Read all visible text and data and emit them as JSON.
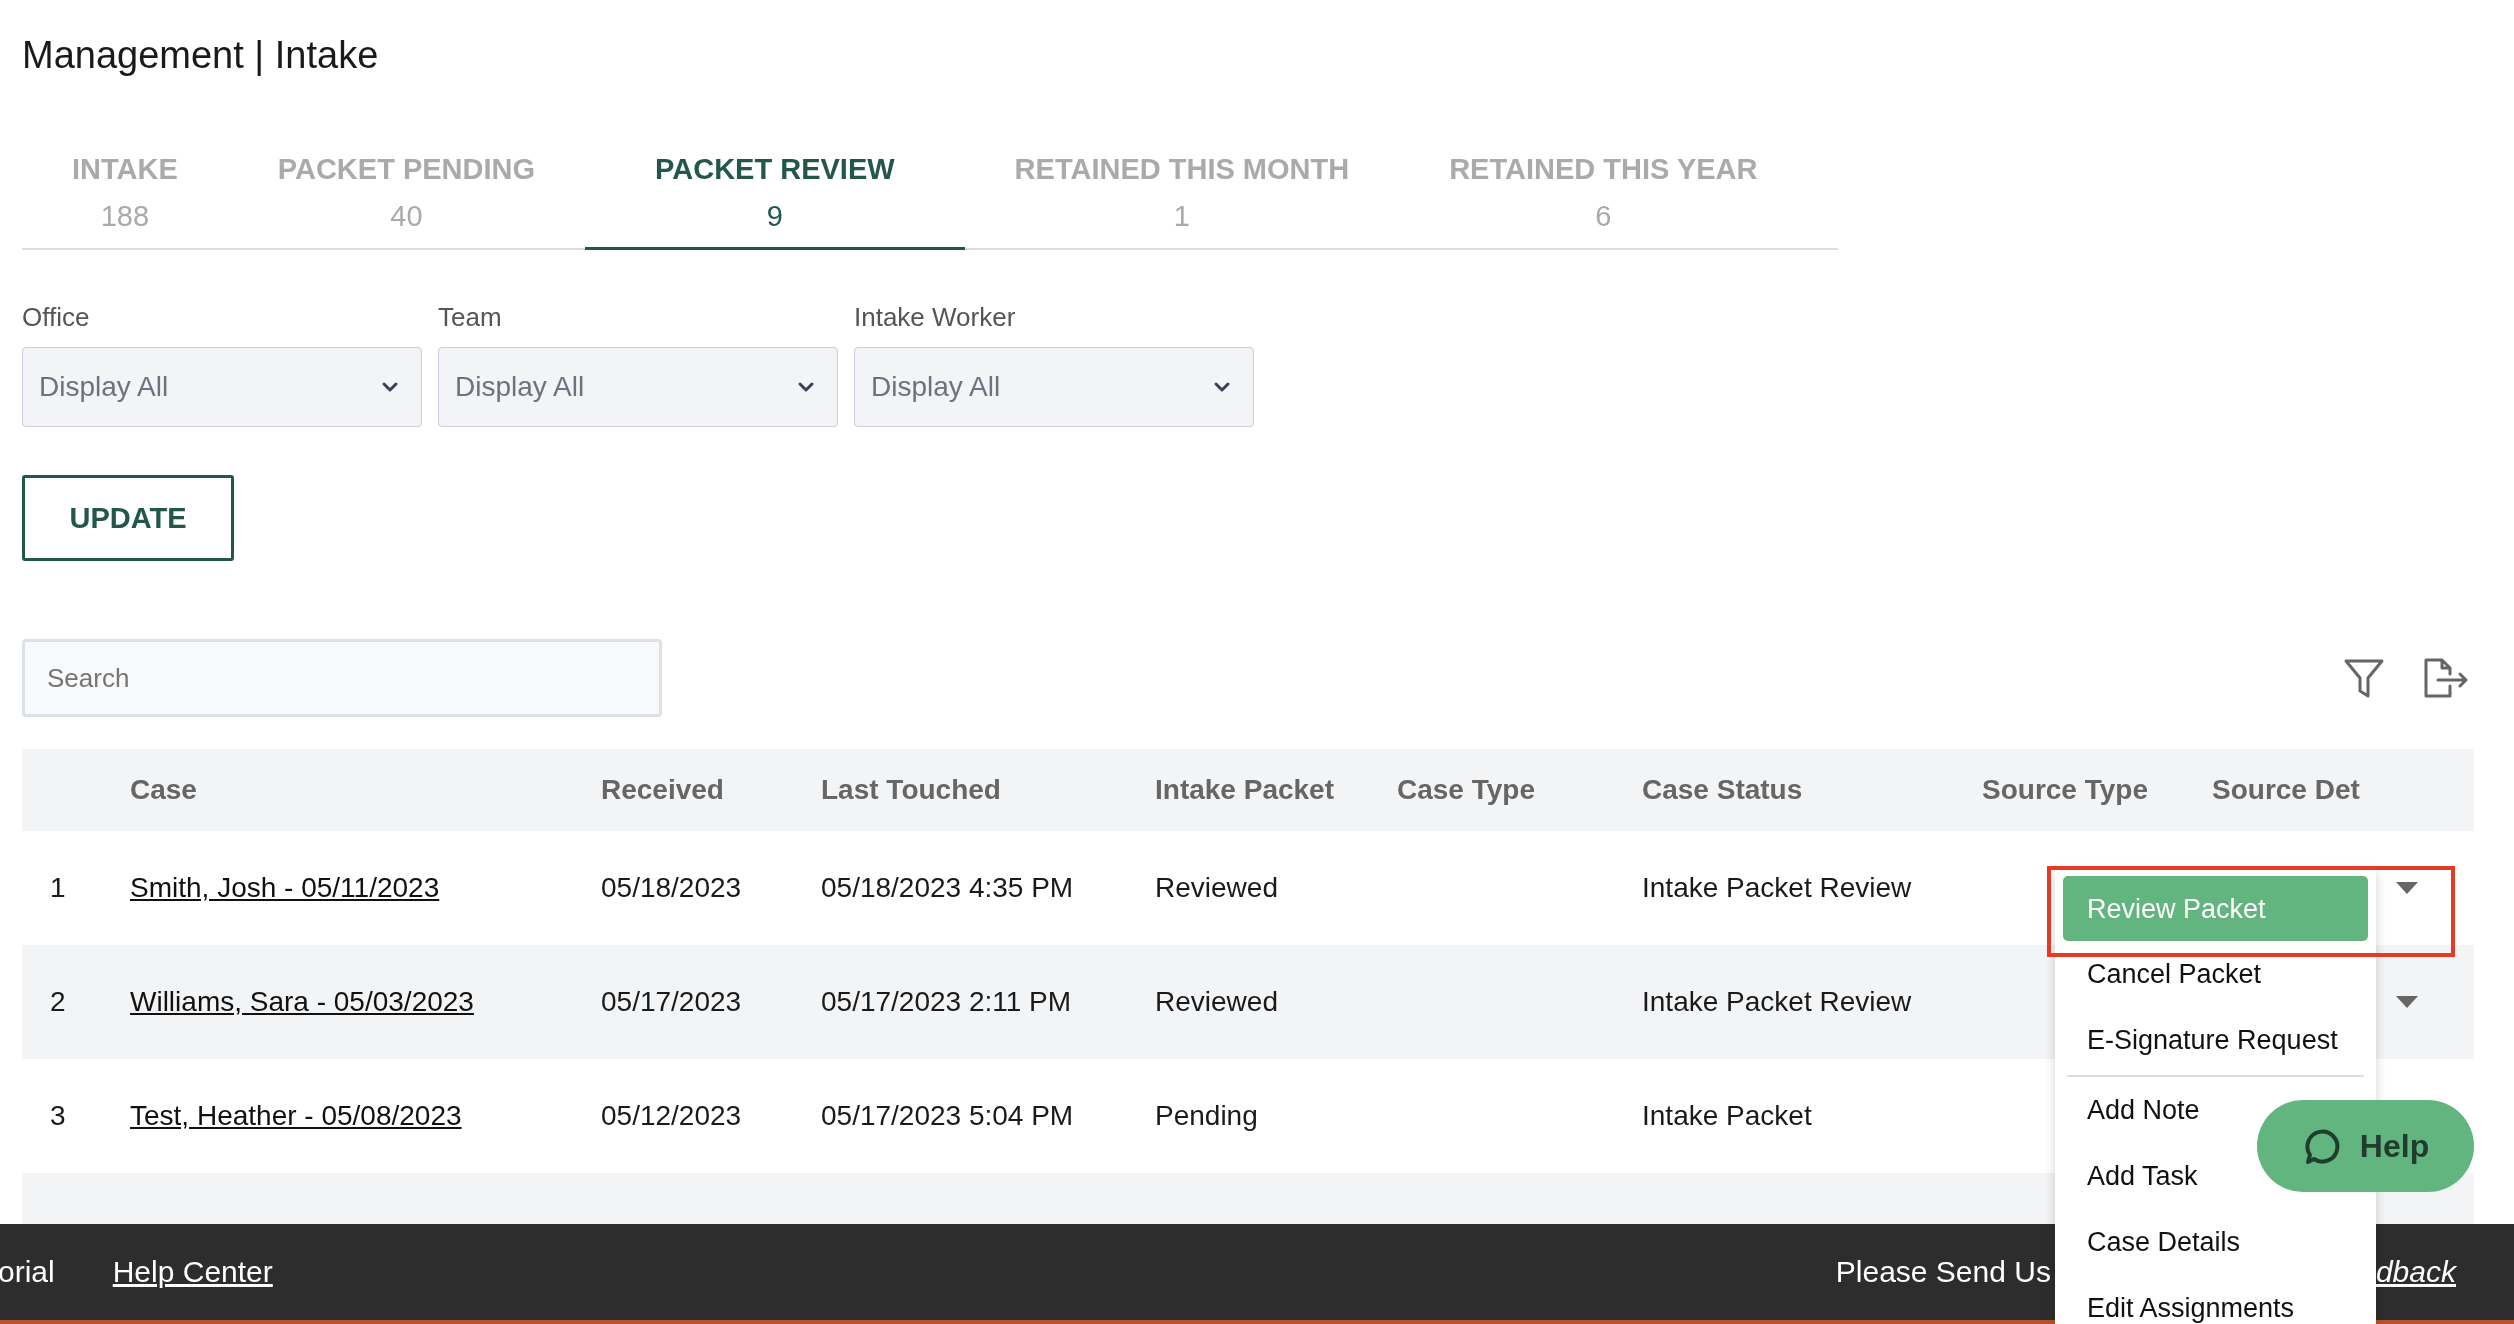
{
  "page_title": "Management | Intake",
  "tabs": [
    {
      "label": "INTAKE",
      "count": "188",
      "selected": false
    },
    {
      "label": "PACKET PENDING",
      "count": "40",
      "selected": false
    },
    {
      "label": "PACKET REVIEW",
      "count": "9",
      "selected": true
    },
    {
      "label": "RETAINED THIS MONTH",
      "count": "1",
      "selected": false
    },
    {
      "label": "RETAINED THIS YEAR",
      "count": "6",
      "selected": false
    }
  ],
  "filters": [
    {
      "label": "Office",
      "value": "Display All"
    },
    {
      "label": "Team",
      "value": "Display All"
    },
    {
      "label": "Intake Worker",
      "value": "Display All"
    }
  ],
  "update_button": "UPDATE",
  "search": {
    "placeholder": "Search"
  },
  "table": {
    "columns": [
      "",
      "Case",
      "Received",
      "Last Touched",
      "Intake Packet",
      "Case Type",
      "Case Status",
      "Source Type",
      "Source Det"
    ],
    "rows": [
      {
        "number": "1",
        "case": "Smith, Josh - 05/11/2023",
        "received": "05/18/2023",
        "last_touched": "05/18/2023 4:35 PM",
        "intake_packet": "Reviewed",
        "case_status": "Intake Packet Review",
        "actions_caret": true
      },
      {
        "number": "2",
        "case": "Williams, Sara - 05/03/2023",
        "received": "05/17/2023",
        "last_touched": "05/17/2023 2:11 PM",
        "intake_packet": "Reviewed",
        "case_status": "Intake Packet Review",
        "actions_caret": true
      },
      {
        "number": "3",
        "case": "Test, Heather - 05/08/2023",
        "received": "05/12/2023",
        "last_touched": "05/17/2023 5:04 PM",
        "intake_packet": "Pending",
        "case_status": "Intake Packet",
        "actions_caret": false
      }
    ]
  },
  "action_menu": {
    "highlighted": true,
    "groups": [
      [
        {
          "label": "Review Packet",
          "selected": true
        },
        {
          "label": "Cancel Packet",
          "selected": false
        },
        {
          "label": "E-Signature Request",
          "selected": false
        }
      ],
      [
        {
          "label": "Add Note",
          "selected": false
        },
        {
          "label": "Add Task",
          "selected": false
        },
        {
          "label": "Case Details",
          "selected": false
        },
        {
          "label": "Edit Assignments",
          "selected": false
        }
      ]
    ]
  },
  "help_button": "Help",
  "footer": {
    "left": [
      {
        "text": "orial",
        "kind": "text"
      },
      {
        "text": "Help Center",
        "kind": "link"
      }
    ],
    "right": [
      {
        "text": "Please Send Us",
        "kind": "text"
      },
      {
        "text": "dback",
        "kind": "link"
      }
    ]
  }
}
